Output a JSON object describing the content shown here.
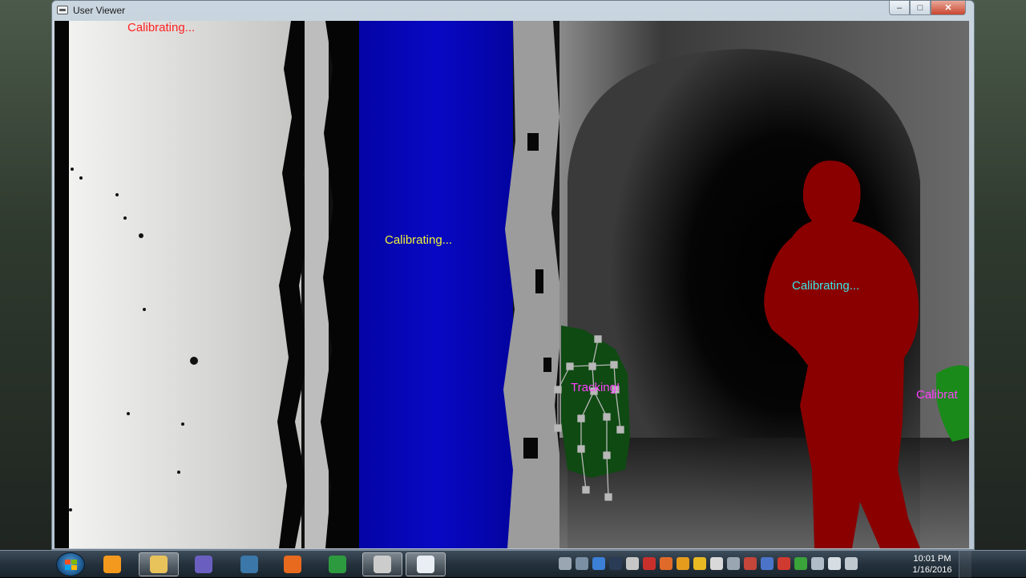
{
  "window": {
    "title": "User Viewer",
    "minimize_label": "–",
    "maximize_label": "□",
    "close_label": "✕"
  },
  "viewer": {
    "labels": [
      {
        "text": "Calibrating...",
        "color": "#ff2020"
      },
      {
        "text": "Calibrating...",
        "color": "#f2f23a"
      },
      {
        "text": "Calibrating...",
        "color": "#38e8e8"
      },
      {
        "text": "Tracking!",
        "color": "#ff40ff"
      },
      {
        "text": "Calibrat",
        "color": "#ff40ff"
      }
    ],
    "user_colors": {
      "user_blue": "#0505b8",
      "user_red": "#8a0000",
      "user_green": "#0f4a12",
      "user_green_right": "#1a8a1a",
      "skeleton": "#b8b8b8"
    }
  },
  "taskbar": {
    "apps": [
      {
        "name": "windows-media-player-icon",
        "color": "#f39a1e",
        "active": false
      },
      {
        "name": "file-explorer-icon",
        "color": "#e8c25a",
        "active": true
      },
      {
        "name": "visual-studio-icon",
        "color": "#6a5fc1",
        "active": false
      },
      {
        "name": "python-icon",
        "color": "#3b77a8",
        "active": false
      },
      {
        "name": "firefox-icon",
        "color": "#e86a1f",
        "active": false
      },
      {
        "name": "chrome-icon",
        "color": "#2e9a3f",
        "active": false
      },
      {
        "name": "film-reel-icon",
        "color": "#cccccc",
        "active": true
      },
      {
        "name": "user-viewer-window-icon",
        "color": "#e8eef4",
        "active": true
      }
    ],
    "tray_icons": [
      {
        "name": "network-tool-icon",
        "color": "#9aa7b3"
      },
      {
        "name": "monitor-icon",
        "color": "#7a8fa3"
      },
      {
        "name": "media-icon",
        "color": "#3b7fd6"
      },
      {
        "name": "steam-icon",
        "color": "#2a3b55"
      },
      {
        "name": "utility-icon",
        "color": "#c6c6c6"
      },
      {
        "name": "red-app-icon",
        "color": "#c9302c"
      },
      {
        "name": "orange-app-icon",
        "color": "#e06a2a"
      },
      {
        "name": "amber-app-icon",
        "color": "#e59b1c"
      },
      {
        "name": "coin-icon",
        "color": "#e8b923"
      },
      {
        "name": "hand-icon",
        "color": "#d9d9d9"
      },
      {
        "name": "device-icon",
        "color": "#9aa7b3"
      },
      {
        "name": "flag-icon",
        "color": "#c4453a"
      },
      {
        "name": "bluetooth-icon",
        "color": "#4b74c9"
      },
      {
        "name": "red-alert-icon",
        "color": "#d13a30"
      },
      {
        "name": "shield-icon",
        "color": "#3aa33a"
      },
      {
        "name": "network-icon",
        "color": "#b0bcc7"
      },
      {
        "name": "volume-icon",
        "color": "#d6dde3"
      },
      {
        "name": "battery-icon",
        "color": "#c0c8cf"
      }
    ],
    "clock_time": "10:01 PM",
    "clock_date": "1/16/2016"
  }
}
